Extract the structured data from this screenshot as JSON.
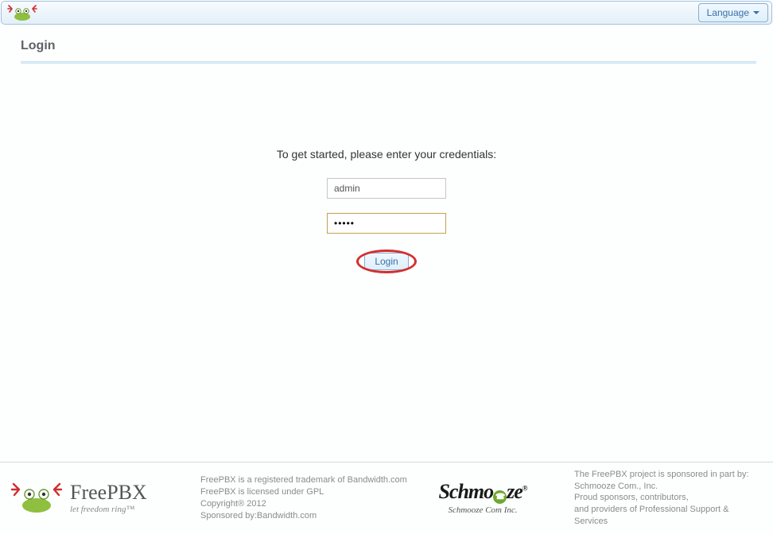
{
  "header": {
    "language_label": "Language"
  },
  "page": {
    "title": "Login",
    "prompt": "To get started, please enter your credentials:"
  },
  "form": {
    "username_value": "admin",
    "password_value": "•••••",
    "login_label": "Login"
  },
  "footer": {
    "brand_left": "FreePBX",
    "tagline_left": "let freedom ring™",
    "left_line1": "FreePBX is a registered trademark of Bandwidth.com",
    "left_line2": "FreePBX is licensed under GPL",
    "left_line3": "Copyright® 2012",
    "left_line4": "Sponsored by:Bandwidth.com",
    "brand_mid_tag": "Schmooze Com Inc.",
    "right_line1": "The FreePBX project is sponsored in part by:",
    "right_line2": "Schmooze Com., Inc.",
    "right_line3": "Proud sponsors, contributors,",
    "right_line4": "and providers of Professional Support & Services"
  }
}
